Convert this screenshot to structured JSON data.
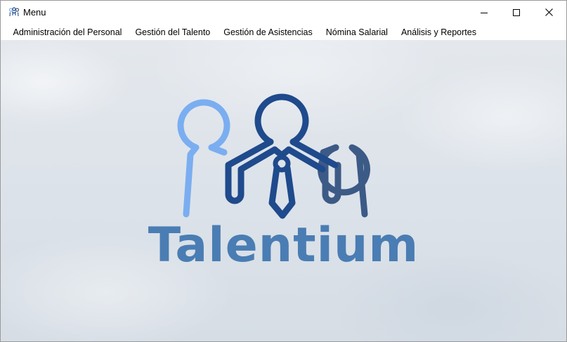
{
  "window": {
    "title": "Menu",
    "icon": "people-icon",
    "controls": {
      "minimize": "minimize-icon",
      "maximize": "maximize-icon",
      "close": "close-icon"
    }
  },
  "menubar": {
    "items": [
      {
        "label": "Administración del Personal"
      },
      {
        "label": "Gestión del Talento"
      },
      {
        "label": "Gestión de Asistencias"
      },
      {
        "label": "Nómina Salarial"
      },
      {
        "label": "Análisis y Reportes"
      }
    ]
  },
  "main": {
    "logo": {
      "icon": "team-people-logo",
      "brand_name": "Talentium",
      "colors": {
        "left_person": "#7aaef0",
        "center_person": "#1f4a8c",
        "right_person": "#3c5a86",
        "brand_text": "#4a7db3"
      }
    }
  }
}
